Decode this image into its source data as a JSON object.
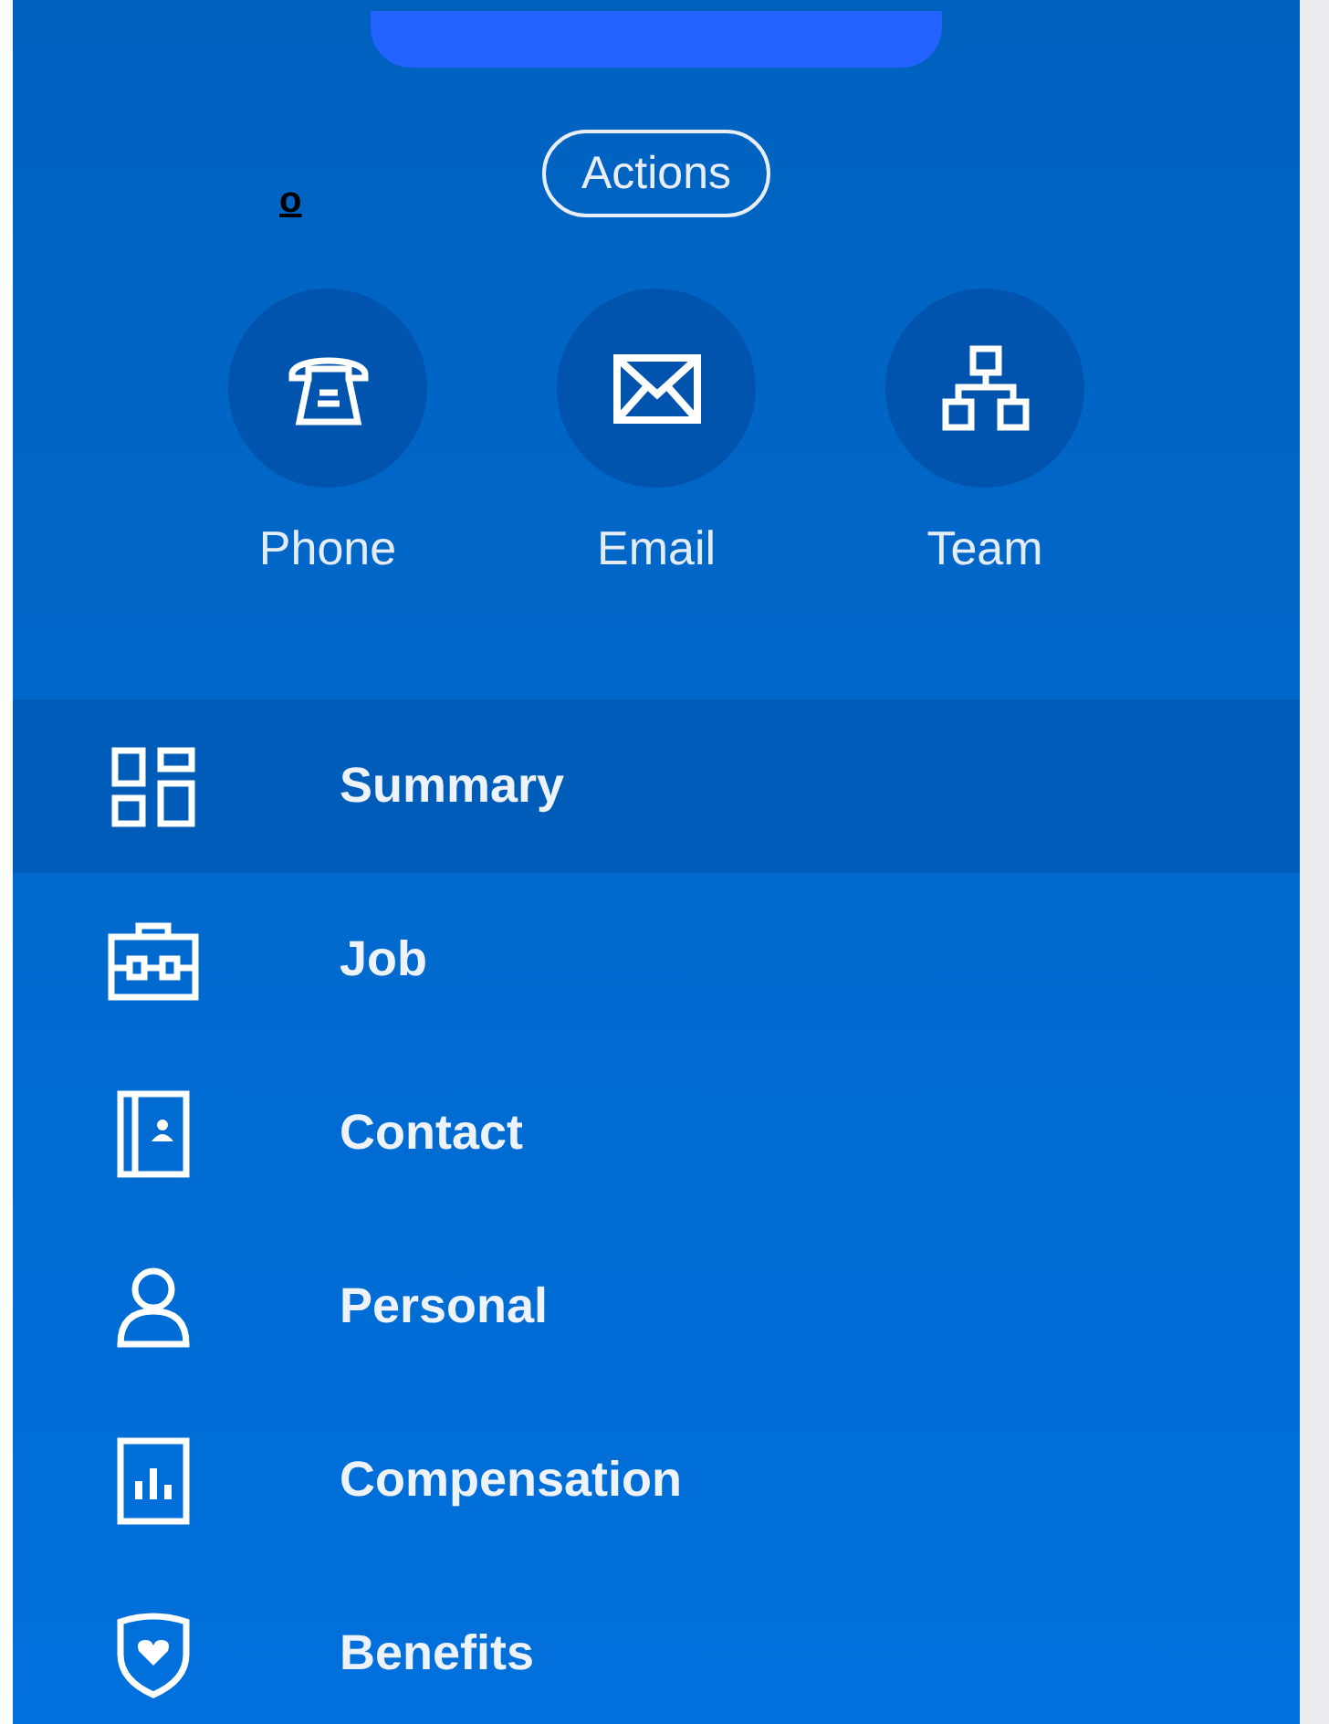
{
  "marker_text": "o",
  "actions_button": "Actions",
  "quick_actions": [
    {
      "label": "Phone"
    },
    {
      "label": "Email"
    },
    {
      "label": "Team"
    }
  ],
  "nav_items": [
    {
      "label": "Summary",
      "selected": true
    },
    {
      "label": "Job",
      "selected": false
    },
    {
      "label": "Contact",
      "selected": false
    },
    {
      "label": "Personal",
      "selected": false
    },
    {
      "label": "Compensation",
      "selected": false
    },
    {
      "label": "Benefits",
      "selected": false
    }
  ]
}
